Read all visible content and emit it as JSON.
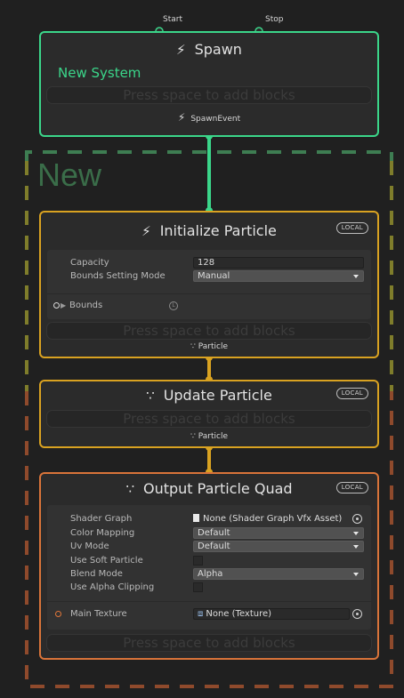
{
  "colors": {
    "background": "#202020",
    "spawn_accent": "#3bd68a",
    "particle_accent": "#d9a221",
    "output_accent": "#d9743a",
    "group_outline_top": "#3e7d52",
    "group_outline_mid": "#7f7d2b",
    "group_outline_bottom": "#8f4a2c",
    "group_title": "#3a6d49"
  },
  "spawn": {
    "start_label": "Start",
    "stop_label": "Stop",
    "title": "Spawn",
    "system_name": "New System",
    "dropzone_hint": "Press space to add blocks",
    "event_label": "SpawnEvent",
    "icon": "lightning-icon"
  },
  "group": {
    "title": "New"
  },
  "initialize": {
    "title": "Initialize Particle",
    "icon": "lightning-icon",
    "space_badge": "LOCAL",
    "props": [
      {
        "label": "Capacity",
        "value": "128"
      },
      {
        "label": "Bounds Setting Mode",
        "value": "Manual"
      }
    ],
    "bounds_label": "Bounds",
    "bounds_space_icon": "local-space-icon",
    "dropzone_hint": "Press space to add blocks",
    "output_label": "Particle"
  },
  "update": {
    "title": "Update Particle",
    "icon": "particle-icon",
    "space_badge": "LOCAL",
    "dropzone_hint": "Press space to add blocks",
    "output_label": "Particle"
  },
  "output": {
    "title": "Output Particle Quad",
    "icon": "particle-icon",
    "space_badge": "LOCAL",
    "shader_graph": {
      "label": "Shader Graph",
      "value": "None (Shader Graph Vfx Asset)"
    },
    "color_mapping": {
      "label": "Color Mapping",
      "value": "Default"
    },
    "uv_mode": {
      "label": "Uv Mode",
      "value": "Default"
    },
    "soft_particle": {
      "label": "Use Soft Particle"
    },
    "blend_mode": {
      "label": "Blend Mode",
      "value": "Alpha"
    },
    "alpha_clipping": {
      "label": "Use Alpha Clipping"
    },
    "main_texture": {
      "label": "Main Texture",
      "value": "None (Texture)"
    },
    "dropzone_hint": "Press space to add blocks"
  }
}
